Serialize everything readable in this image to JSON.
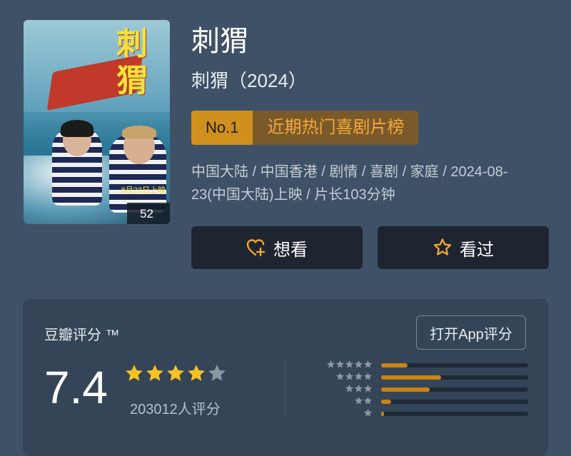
{
  "movie": {
    "title": "刺猬",
    "subtitle": "刺猬（2024）",
    "rank_no": "No.1",
    "rank_label": "近期热门喜剧片榜",
    "meta": "中国大陆 / 中国香港 / 剧情 / 喜剧 / 家庭 / 2024-08-23(中国大陆)上映 / 片长103分钟"
  },
  "poster": {
    "title_text": "刺猬",
    "date_text": "8月23日上映",
    "badge": "52"
  },
  "buttons": {
    "want": "想看",
    "seen": "看过"
  },
  "rating": {
    "label": "豆瓣评分 ™",
    "open_app": "打开App评分",
    "score": "7.4",
    "stars_filled": 4,
    "stars_total": 5,
    "count": "203012人评分",
    "distribution": [
      {
        "stars": 5,
        "fraction": 0.18
      },
      {
        "stars": 4,
        "fraction": 0.41
      },
      {
        "stars": 3,
        "fraction": 0.33
      },
      {
        "stars": 2,
        "fraction": 0.07
      },
      {
        "stars": 1,
        "fraction": 0.02
      }
    ]
  },
  "colors": {
    "background": "#3f5166",
    "accent": "#e3a630",
    "star_filled": "#f5c126",
    "star_empty": "#8a96a3",
    "bar_fill": "#c98313"
  }
}
